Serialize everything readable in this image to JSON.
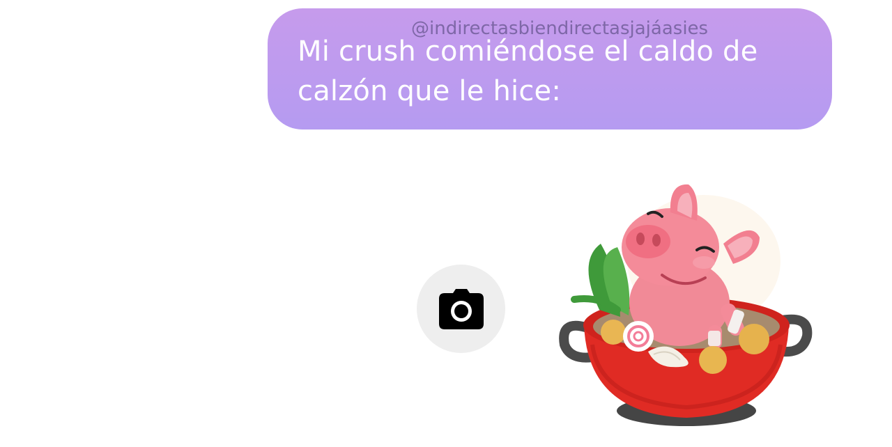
{
  "message": {
    "text": "Mi crush comiéndose el caldo de calzón que le hice:",
    "bubble_color_top": "#c69bec",
    "bubble_color_bottom": "#b59bf1",
    "text_color": "#ffffff"
  },
  "watermark": {
    "text": "@indirectasbiendirectasjajáasies"
  },
  "composer": {
    "camera_icon": "camera-icon"
  },
  "sticker": {
    "icon": "pig-in-hotpot-sticker"
  }
}
